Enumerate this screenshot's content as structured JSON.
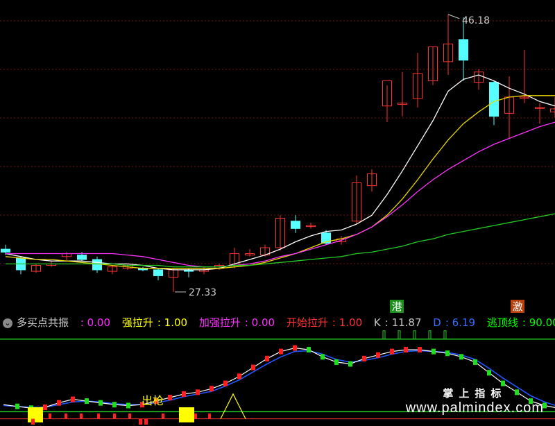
{
  "legend": {
    "name": "多买点共振",
    "items": [
      {
        "label": "",
        "value": ": 0.00",
        "color": "#ff2fff"
      },
      {
        "label": "强拉升",
        "value": ": 1.00",
        "color": "#ffff00"
      },
      {
        "label": "加强拉升",
        "value": ": 0.00",
        "color": "#ff2fff"
      },
      {
        "label": "开始拉升",
        "value": ": 1.00",
        "color": "#ff3030"
      },
      {
        "label": "K",
        "value": ": 11.87",
        "color": "#c8c8c8"
      },
      {
        "label": "D",
        "value": ": 6.19",
        "color": "#3a6cff"
      },
      {
        "label": "逃顶线",
        "value": ": 90.00",
        "color": "#00ff00"
      },
      {
        "label": "拉",
        "value": "",
        "color": "#00ff00"
      }
    ]
  },
  "annotations": {
    "high_label": "46.18",
    "low_label": "27.33",
    "signal_gang": "港",
    "signal_ji": "激",
    "signal_chuqiang": "出枪"
  },
  "watermark": {
    "top": "掌上指标",
    "url": "www.palmindex.com"
  },
  "colors": {
    "up": "#ff3333",
    "down": "#55ffff",
    "ma1": "#ffffff",
    "ma2": "#e8d800",
    "ma3": "#ff33ff",
    "ma4": "#22cc22",
    "k_line": "#ffffff",
    "d_line": "#2255ff",
    "grid": "#7a1515"
  },
  "chart_data": {
    "type": "candlestick",
    "price_range": [
      26.5,
      46.8
    ],
    "candles": [
      {
        "o": 30.3,
        "h": 30.6,
        "l": 29.9,
        "c": 30.1
      },
      {
        "o": 29.7,
        "h": 29.8,
        "l": 28.6,
        "c": 28.9
      },
      {
        "o": 28.8,
        "h": 29.3,
        "l": 28.7,
        "c": 29.2
      },
      {
        "o": 29.2,
        "h": 29.5,
        "l": 29.1,
        "c": 29.3
      },
      {
        "o": 29.8,
        "h": 30.1,
        "l": 29.5,
        "c": 30.0
      },
      {
        "o": 29.9,
        "h": 30.1,
        "l": 29.5,
        "c": 29.6
      },
      {
        "o": 29.6,
        "h": 29.8,
        "l": 28.7,
        "c": 28.9
      },
      {
        "o": 28.8,
        "h": 29.2,
        "l": 28.6,
        "c": 29.1
      },
      {
        "o": 29.0,
        "h": 29.3,
        "l": 28.9,
        "c": 29.2
      },
      {
        "o": 29.0,
        "h": 29.1,
        "l": 28.8,
        "c": 28.9
      },
      {
        "o": 28.9,
        "h": 29.0,
        "l": 28.2,
        "c": 28.5
      },
      {
        "o": 28.4,
        "h": 29.0,
        "l": 27.4,
        "c": 28.9
      },
      {
        "o": 28.9,
        "h": 29.0,
        "l": 28.4,
        "c": 28.8
      },
      {
        "o": 28.8,
        "h": 29.1,
        "l": 28.6,
        "c": 28.9
      },
      {
        "o": 29.0,
        "h": 29.3,
        "l": 28.9,
        "c": 29.2
      },
      {
        "o": 29.2,
        "h": 30.4,
        "l": 29.0,
        "c": 30.0
      },
      {
        "o": 29.9,
        "h": 30.3,
        "l": 29.8,
        "c": 30.0
      },
      {
        "o": 29.9,
        "h": 30.6,
        "l": 29.8,
        "c": 30.4
      },
      {
        "o": 30.4,
        "h": 32.6,
        "l": 30.2,
        "c": 32.4
      },
      {
        "o": 32.2,
        "h": 32.6,
        "l": 31.4,
        "c": 31.7
      },
      {
        "o": 31.9,
        "h": 32.1,
        "l": 31.7,
        "c": 31.9
      },
      {
        "o": 31.4,
        "h": 31.6,
        "l": 30.6,
        "c": 30.7
      },
      {
        "o": 30.8,
        "h": 31.2,
        "l": 30.6,
        "c": 31.0
      },
      {
        "o": 32.2,
        "h": 35.3,
        "l": 32.0,
        "c": 34.8
      },
      {
        "o": 34.6,
        "h": 35.7,
        "l": 34.2,
        "c": 35.4
      },
      {
        "o": 40.0,
        "h": 41.4,
        "l": 38.9,
        "c": 41.7
      },
      {
        "o": 40.1,
        "h": 42.3,
        "l": 39.3,
        "c": 40.2
      },
      {
        "o": 40.5,
        "h": 43.6,
        "l": 39.9,
        "c": 42.2
      },
      {
        "o": 41.7,
        "h": 44.0,
        "l": 41.4,
        "c": 44.0
      },
      {
        "o": 43.0,
        "h": 46.2,
        "l": 42.1,
        "c": 44.2
      },
      {
        "o": 44.5,
        "h": 46.0,
        "l": 41.7,
        "c": 43.1
      },
      {
        "o": 41.6,
        "h": 42.5,
        "l": 41.1,
        "c": 42.3
      },
      {
        "o": 41.6,
        "h": 41.7,
        "l": 38.7,
        "c": 39.3
      },
      {
        "o": 39.5,
        "h": 42.0,
        "l": 37.8,
        "c": 40.6
      },
      {
        "o": 40.6,
        "h": 43.8,
        "l": 40.2,
        "c": 40.6
      },
      {
        "o": 39.9,
        "h": 40.2,
        "l": 38.8,
        "c": 39.9
      },
      {
        "o": 39.6,
        "h": 40.6,
        "l": 39.2,
        "c": 39.8
      }
    ],
    "ma_series": [
      {
        "values": [
          30.0,
          29.8,
          29.6,
          29.5,
          29.5,
          29.5,
          29.4,
          29.3,
          29.3,
          29.2,
          29.0,
          28.9,
          28.9,
          28.9,
          29.0,
          29.3,
          29.6,
          29.9,
          30.3,
          30.8,
          31.2,
          31.5,
          31.6,
          32.0,
          32.6,
          34.0,
          35.6,
          37.3,
          39.0,
          41.0,
          41.8,
          42.1,
          41.7,
          41.2,
          40.8,
          40.3,
          40.0
        ]
      },
      {
        "values": [
          29.8,
          29.7,
          29.6,
          29.6,
          29.5,
          29.4,
          29.3,
          29.2,
          29.1,
          29.0,
          29.0,
          29.0,
          29.0,
          29.0,
          29.0,
          29.1,
          29.2,
          29.4,
          29.7,
          30.0,
          30.4,
          30.8,
          31.0,
          31.3,
          31.8,
          32.6,
          33.7,
          35.0,
          36.4,
          37.7,
          38.8,
          39.6,
          40.3,
          40.6,
          40.7,
          40.7,
          40.7
        ]
      },
      {
        "values": [
          30.0,
          30.0,
          30.0,
          30.0,
          30.0,
          30.0,
          30.0,
          30.0,
          29.9,
          29.8,
          29.6,
          29.4,
          29.2,
          29.1,
          29.1,
          29.2,
          29.3,
          29.5,
          29.8,
          30.0,
          30.3,
          30.6,
          30.9,
          31.3,
          31.8,
          32.5,
          33.3,
          34.2,
          35.0,
          35.7,
          36.3,
          36.9,
          37.4,
          37.8,
          38.2,
          38.6,
          38.9
        ]
      },
      {
        "values": [
          29.3,
          29.3,
          29.3,
          29.3,
          29.3,
          29.3,
          29.3,
          29.3,
          29.2,
          29.2,
          29.2,
          29.1,
          29.1,
          29.1,
          29.1,
          29.2,
          29.2,
          29.3,
          29.4,
          29.5,
          29.6,
          29.7,
          29.8,
          30.0,
          30.1,
          30.3,
          30.5,
          30.8,
          31.0,
          31.3,
          31.5,
          31.7,
          31.9,
          32.1,
          32.3,
          32.5,
          32.7
        ]
      }
    ],
    "indicator": {
      "y_range": [
        -5,
        100
      ],
      "escape_line": 90,
      "k": [
        16,
        14,
        12,
        13,
        18,
        22,
        20,
        18,
        16,
        15,
        16,
        20,
        24,
        28,
        30,
        34,
        40,
        48,
        58,
        68,
        76,
        80,
        78,
        70,
        64,
        62,
        68,
        72,
        76,
        78,
        78,
        76,
        74,
        70,
        64,
        52,
        40,
        30,
        20,
        15,
        12
      ],
      "d": [
        15,
        14,
        13,
        13,
        16,
        19,
        20,
        19,
        17,
        16,
        16,
        18,
        21,
        25,
        28,
        31,
        37,
        44,
        53,
        62,
        70,
        76,
        77,
        73,
        67,
        64,
        66,
        69,
        73,
        76,
        77,
        76,
        75,
        72,
        67,
        57,
        46,
        36,
        26,
        19,
        14
      ]
    }
  }
}
